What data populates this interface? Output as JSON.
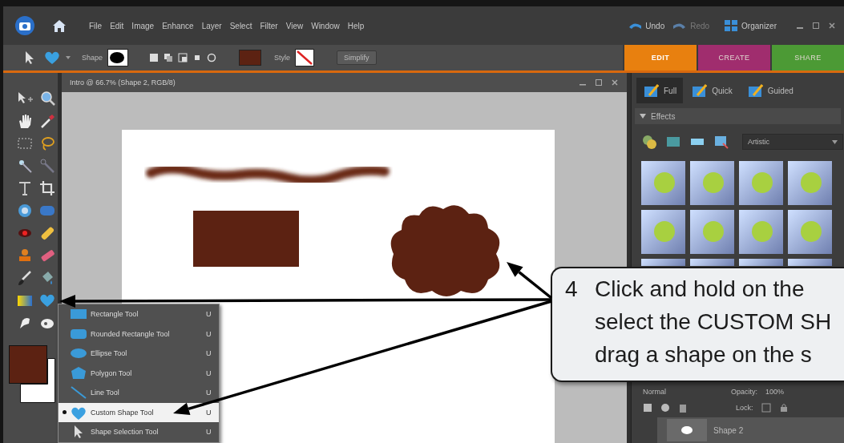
{
  "menu_bar": {
    "menus": [
      "File",
      "Edit",
      "Image",
      "Enhance",
      "Layer",
      "Select",
      "Filter",
      "View",
      "Window",
      "Help"
    ],
    "undo": {
      "label": "Undo",
      "disabled": false
    },
    "redo": {
      "label": "Redo",
      "disabled": true
    },
    "organizer": "Organizer"
  },
  "options_bar": {
    "shape_label": "Shape",
    "style_label": "Style",
    "simplify": "Simplify"
  },
  "mode_tabs": [
    {
      "label": "EDIT",
      "selected": true,
      "color": "#e8800f"
    },
    {
      "label": "CREATE",
      "selected": false,
      "color": "#a02d6e"
    },
    {
      "label": "SHARE",
      "selected": false,
      "color": "#4c9a35"
    }
  ],
  "document": {
    "title": "Intro @ 66.7% (Shape 2, RGB/8)"
  },
  "panel_tabs": [
    {
      "label": "Full",
      "selected": true
    },
    {
      "label": "Quick",
      "selected": false
    },
    {
      "label": "Guided",
      "selected": false
    }
  ],
  "effects": {
    "title": "Effects",
    "expanded": true,
    "category": "Artistic"
  },
  "layers": {
    "blend_mode": "Normal",
    "opacity_label": "Opacity:",
    "opacity": "100%",
    "lock_label": "Lock:",
    "layer_name": "Shape 2"
  },
  "shape_menu": [
    {
      "kind": "rectangle",
      "label": "Rectangle Tool",
      "shortcut": "U",
      "selected": false
    },
    {
      "kind": "rounded",
      "label": "Rounded Rectangle Tool",
      "shortcut": "U",
      "selected": false
    },
    {
      "kind": "ellipse",
      "label": "Ellipse Tool",
      "shortcut": "U",
      "selected": false
    },
    {
      "kind": "polygon",
      "label": "Polygon Tool",
      "shortcut": "U",
      "selected": false
    },
    {
      "kind": "line",
      "label": "Line Tool",
      "shortcut": "U",
      "selected": false
    },
    {
      "kind": "custom",
      "label": "Custom Shape Tool",
      "shortcut": "U",
      "selected": true
    },
    {
      "kind": "selection",
      "label": "Shape Selection Tool",
      "shortcut": "U",
      "selected": false
    }
  ],
  "callout": {
    "number": "4",
    "lines": [
      "Click and hold on the",
      "select the CUSTOM SH",
      "drag a shape on the s"
    ]
  }
}
